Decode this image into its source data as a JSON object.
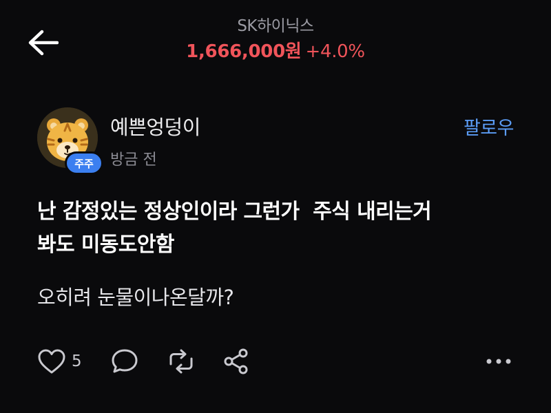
{
  "header": {
    "stock_name": "SK하이닉스",
    "stock_price": "1,666,000원",
    "stock_change": "+4.0%",
    "price_color": "#f0545a",
    "back_icon": "arrow-left-icon"
  },
  "author": {
    "name": "예쁜엉덩이",
    "time": "방금 전",
    "badge": "주주",
    "avatar_icon": "tiger-avatar",
    "follow_label": "팔로우",
    "accent_color": "#5b9cf5"
  },
  "post": {
    "title_lines": [
      "난 감정있는 정상인이라 그런가  주식 내리는거",
      "봐도 미동도안함"
    ],
    "body": "오히려 눈물이나온달까?"
  },
  "actions": {
    "like_count": "5",
    "icons": [
      "heart-icon",
      "comment-icon",
      "repost-icon",
      "share-icon",
      "more-icon"
    ]
  }
}
